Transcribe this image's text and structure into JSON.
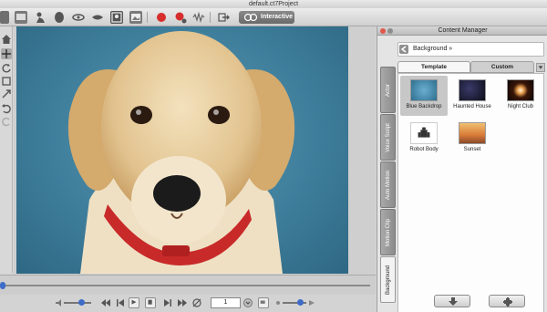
{
  "window": {
    "title": "default.ct7Project"
  },
  "toolbar": {
    "interactive_label": "Interactive",
    "icons": [
      "character-icon",
      "scene-icon",
      "pose-icon",
      "head-icon",
      "eye-icon",
      "mouth-icon",
      "portrait-icon",
      "image-icon",
      "record-icon",
      "record-voice-icon",
      "waveform-icon",
      "export-icon",
      "interactive-icon"
    ]
  },
  "playback": {
    "frame": "1"
  },
  "content_manager": {
    "title": "Content Manager",
    "breadcrumb": "Background",
    "side_tabs": [
      "Actor",
      "Voice Script",
      "Auto Motion",
      "Motion Clip",
      "Background"
    ],
    "top_tabs": [
      "Template",
      "Custom"
    ],
    "items": [
      {
        "label": "Blue Backdrop",
        "selected": true,
        "color": "#3f86a6"
      },
      {
        "label": "Haunted House",
        "selected": false,
        "color": "#141424"
      },
      {
        "label": "Night Club",
        "selected": false,
        "color": "#1a0c08"
      },
      {
        "label": "Robot Body",
        "selected": false,
        "color": "#ffffff"
      },
      {
        "label": "Sunset",
        "selected": false,
        "color": "#d98a3a"
      }
    ]
  },
  "colors": {
    "accent": "#3d6cc8",
    "backdrop": "#3f7f9c",
    "collar": "#c82a2a"
  }
}
